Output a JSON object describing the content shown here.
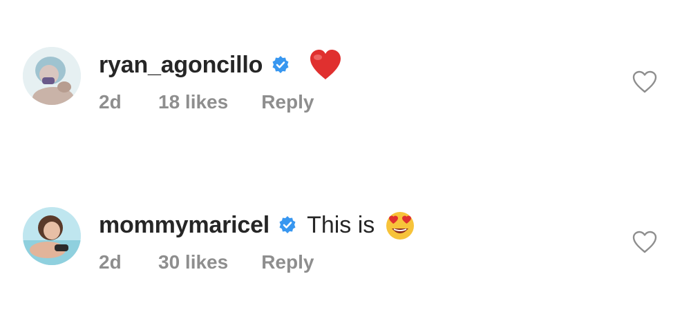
{
  "comments": [
    {
      "username": "ryan_agoncillo",
      "text": "",
      "emoji": "red-heart",
      "time": "2d",
      "likes": "18 likes",
      "reply_label": "Reply"
    },
    {
      "username": "mommymaricel",
      "text": "This is",
      "emoji": "heart-eyes-smiley",
      "time": "2d",
      "likes": "30 likes",
      "reply_label": "Reply"
    }
  ],
  "colors": {
    "text": "#262626",
    "meta": "#8e8e8e",
    "verified": "#3897f0",
    "heart_emoji": "#e0302f"
  },
  "icons": {
    "verified": "verified-badge-icon",
    "like": "heart-outline-icon"
  }
}
